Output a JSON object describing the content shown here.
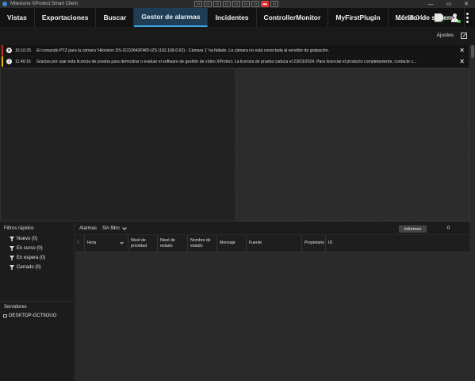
{
  "window": {
    "title": "Milestone XProtect Smart Client",
    "tools": [
      "▭",
      "▭",
      "▭",
      "▭",
      "▭",
      "▭",
      "▭",
      "▬",
      "▭"
    ],
    "controls": {
      "minimize": "—",
      "maximize": "▭",
      "close": "✕"
    }
  },
  "nav": {
    "tabs": [
      "Vistas",
      "Exportaciones",
      "Buscar",
      "Gestor de alarmas",
      "Incidentes",
      "ControllerMonitor",
      "MyFirstPlugin",
      "Monitor de sistema"
    ],
    "active_tab": "Gestor de alarmas",
    "time": "16:18:04"
  },
  "subheader": {
    "settings_label": "Ajustes"
  },
  "notifications": [
    {
      "type": "error",
      "icon": "✕",
      "time": "15:16:25",
      "message": "El comando PTZ para la cámara 'Hikvision DS-2CD2642FWD-IZS (192.168.0.62) - Cámara 1' ha fallado. La cámara no está conectada al servidor de grabación.",
      "close": "✕"
    },
    {
      "type": "warning",
      "icon": "!",
      "time": "11:49:16",
      "message": "Gracias por usar esta licencia de prueba para demostrar o evaluar el software de gestión de vídeo XProtect. La licencia de prueba caduca el 23/03/2024. Para licenciar el producto completamente, contacte c...",
      "close": "✕"
    }
  ],
  "quick_filters": {
    "title": "Filtros rápidos",
    "items": [
      "Nuevo (0)",
      "En curso (0)",
      "En espera (0)",
      "Cerrado (0)"
    ]
  },
  "servers": {
    "title": "Servidores",
    "items": [
      "DESKTOP-GCT9OUO"
    ]
  },
  "alarm_list": {
    "label": "Alarmas",
    "filter": "Sin filtro",
    "reports_button": "Informes",
    "count": "0",
    "columns": [
      "!",
      "Hora",
      "Nivel de prioridad",
      "Nivel de estado",
      "Nombre de estado",
      "Mensaje",
      "Fuente",
      "Propietario",
      "ID"
    ]
  },
  "colors": {
    "accent": "#3ea6e6",
    "active_tab_bg": "#1f3d55",
    "error": "#c42b2b",
    "warning": "#e6b800"
  }
}
